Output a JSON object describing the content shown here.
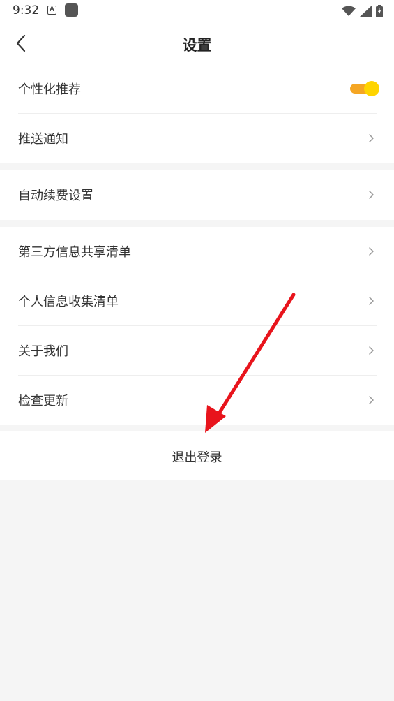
{
  "status_bar": {
    "time": "9:32",
    "notification_icons": [
      "a-icon",
      "app-square-icon"
    ],
    "system_icons": [
      "wifi-icon",
      "signal-icon",
      "battery-icon"
    ]
  },
  "nav": {
    "title": "设置",
    "back_icon": "chevron-left-icon"
  },
  "groups": [
    {
      "items": [
        {
          "label": "个性化推荐",
          "control": "toggle",
          "toggle_on": true
        },
        {
          "label": "推送通知",
          "control": "chevron"
        }
      ]
    },
    {
      "items": [
        {
          "label": "自动续费设置",
          "control": "chevron"
        }
      ]
    },
    {
      "items": [
        {
          "label": "第三方信息共享清单",
          "control": "chevron"
        },
        {
          "label": "个人信息收集清单",
          "control": "chevron"
        },
        {
          "label": "关于我们",
          "control": "chevron"
        },
        {
          "label": "检查更新",
          "control": "chevron"
        }
      ]
    }
  ],
  "logout": {
    "label": "退出登录"
  },
  "colors": {
    "toggle_track": "#f5a623",
    "toggle_knob": "#ffd400",
    "annotation_arrow": "#e8141c",
    "page_background": "#f5f5f5"
  }
}
